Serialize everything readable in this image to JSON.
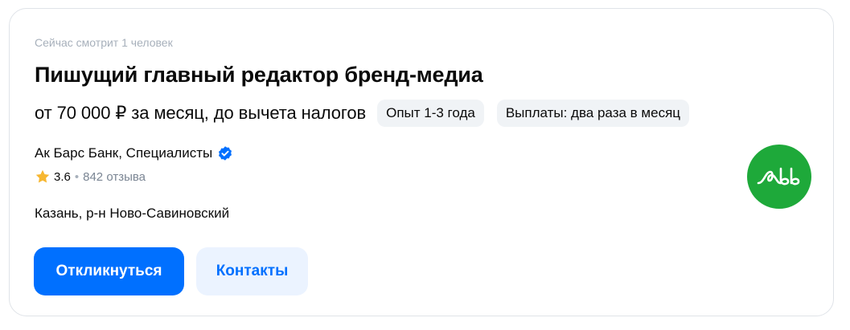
{
  "vacancy": {
    "viewers_text": "Сейчас смотрит 1 человек",
    "title": "Пишущий главный редактор бренд-медиа",
    "salary": "от 70 000 ₽ за месяц, до вычета налогов",
    "tags": [
      "Опыт 1-3 года",
      "Выплаты: два раза в месяц"
    ],
    "company": {
      "name": "Ак Барс Банк, Специалисты",
      "verified_icon": "verified-check-icon",
      "rating": "3.6",
      "reviews": "842 отзыва",
      "logo_color": "#1ea93a",
      "logo_icon": "ak-bars-logo"
    },
    "location": "Казань, р-н Ново-Савиновский"
  },
  "actions": {
    "respond_label": "Откликнуться",
    "contacts_label": "Контакты"
  },
  "colors": {
    "accent": "#0070ff",
    "accent_soft": "#ebf3ff",
    "chip_bg": "#f0f3f6",
    "muted_text": "#a7b0bb",
    "star": "#f7b731"
  }
}
